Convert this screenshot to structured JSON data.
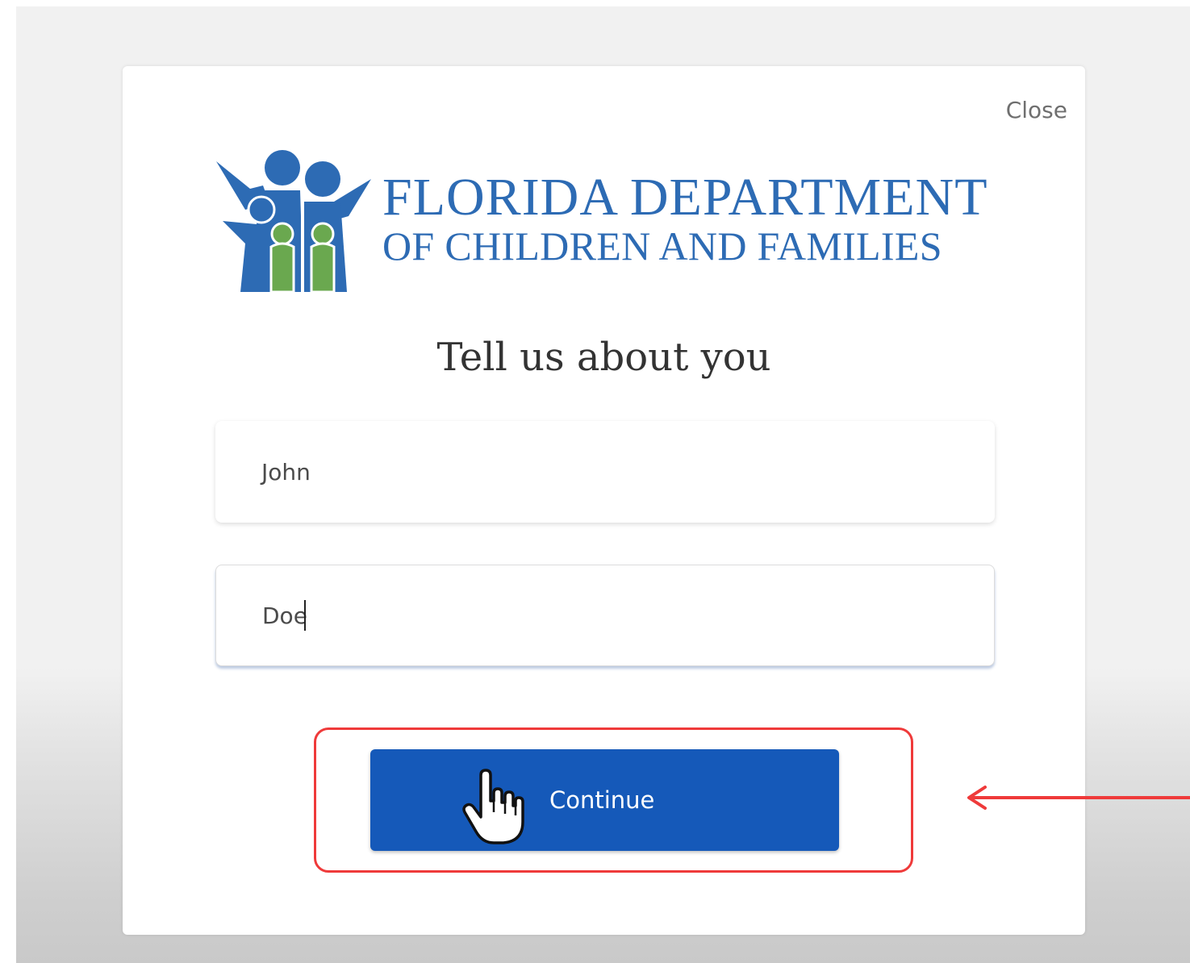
{
  "modal": {
    "close_label": "Close",
    "logo": {
      "line1": "FLORIDA DEPARTMENT",
      "line2": "OF CHILDREN AND FAMILIES"
    },
    "title": "Tell us about you",
    "fields": {
      "first_name_value": "John",
      "last_name_value": "Doe"
    },
    "continue_label": "Continue"
  },
  "colors": {
    "brand_blue": "#2d6bb4",
    "logo_green": "#6aa84f",
    "button_blue": "#1559b9",
    "annotation_red": "#ef3a3a"
  },
  "icons": {
    "cursor": "hand-pointer-icon",
    "annotation": "arrow-left-icon"
  }
}
